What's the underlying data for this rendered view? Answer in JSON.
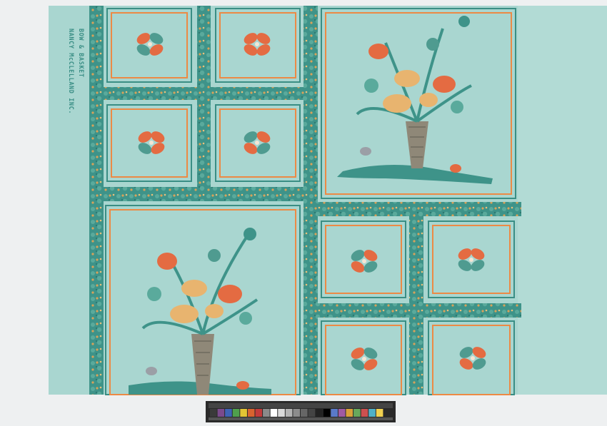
{
  "imprint": {
    "line1": "BOW & BASKET",
    "line2": "NANCY McCLELLAND INC."
  },
  "colors": {
    "paper": "#a9d6d0",
    "paper_right": "#b2dbd5",
    "garland": "#3e9389",
    "garland_dark": "#2c7a72",
    "leaf": "#5aaa9c",
    "berry": "#d7a25a",
    "frame_orange": "#ec8a45",
    "frame_teal": "#3a8e84",
    "bow_orange": "#e46b42",
    "bow_teal": "#4f9b90",
    "poppy": "#e46b42",
    "peony": "#e8b46f",
    "vase": "#8f8878",
    "butterfly_grey": "#9b9fa6",
    "background": "#eef0f1"
  },
  "color_bar": {
    "swatches": [
      "#3a3a3a",
      "#7b4a8c",
      "#3f63b5",
      "#4fa04d",
      "#e2c434",
      "#d8632f",
      "#c23b3b",
      "#8a8a8a",
      "#ffffff",
      "#d9d9d9",
      "#b3b3b3",
      "#8c8c8c",
      "#666666",
      "#444444",
      "#222222",
      "#000000",
      "#5a7ac9",
      "#a05aa3",
      "#d9a13a",
      "#68a85c",
      "#cc5050",
      "#50b0c8",
      "#f0d050",
      "#2a2a2a"
    ]
  }
}
